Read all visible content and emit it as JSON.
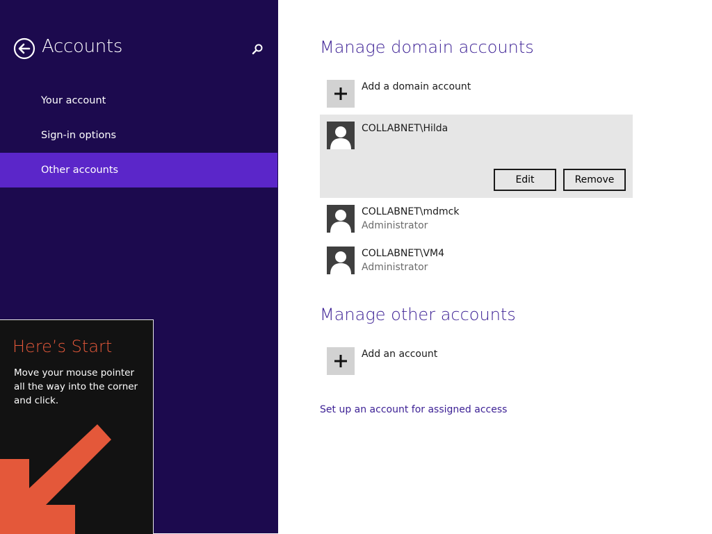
{
  "sidebar": {
    "title": "Accounts",
    "items": [
      {
        "label": "Your account"
      },
      {
        "label": "Sign-in options"
      },
      {
        "label": "Other accounts"
      }
    ]
  },
  "start_tip": {
    "title": "Here’s Start",
    "text": "Move your mouse pointer all the way into the corner and click."
  },
  "main": {
    "domain": {
      "title": "Manage domain accounts",
      "add_label": "Add a domain account",
      "accounts": [
        {
          "name": "COLLABNET\\Hilda",
          "role": ""
        },
        {
          "name": "COLLABNET\\mdmck",
          "role": "Administrator"
        },
        {
          "name": "COLLABNET\\VM4",
          "role": "Administrator"
        }
      ],
      "edit_label": "Edit",
      "remove_label": "Remove"
    },
    "other": {
      "title": "Manage other accounts",
      "add_label": "Add an account",
      "assigned_access_link": "Set up an account for assigned access"
    }
  },
  "colors": {
    "sidebar_bg": "#1c0a4e",
    "selected_nav": "#5b26c9",
    "heading": "#3b1f94",
    "start_accent": "#e4583a"
  }
}
